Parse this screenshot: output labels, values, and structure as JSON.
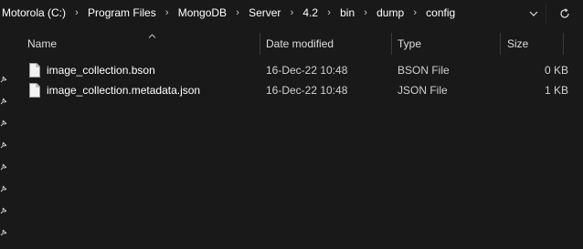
{
  "address": {
    "crumbs": [
      "Motorola (C:)",
      "Program Files",
      "MongoDB",
      "Server",
      "4.2",
      "bin",
      "dump",
      "config"
    ],
    "separator": "›",
    "dropdown_icon": "chevron-down-icon",
    "refresh_icon": "refresh-icon"
  },
  "columns": {
    "name": "Name",
    "date_modified": "Date modified",
    "type": "Type",
    "size": "Size"
  },
  "files": [
    {
      "name": "image_collection.bson",
      "date_modified": "16-Dec-22 10:48",
      "type": "BSON File",
      "size": "0 KB"
    },
    {
      "name": "image_collection.metadata.json",
      "date_modified": "16-Dec-22 10:48",
      "type": "JSON File",
      "size": "1 KB"
    }
  ],
  "colors": {
    "background": "#191919",
    "text": "#ffffff",
    "separator": "#3b3b3b"
  }
}
